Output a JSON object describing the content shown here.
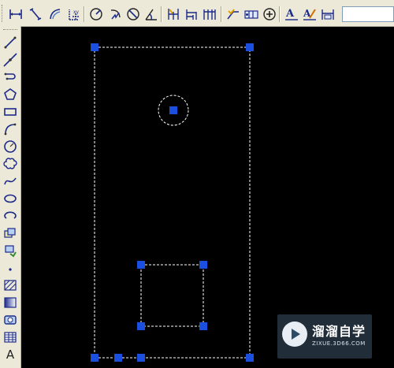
{
  "top_toolbar": {
    "tools": [
      {
        "name": "linear-dimension-icon"
      },
      {
        "name": "aligned-dimension-icon"
      },
      {
        "name": "arc-length-dimension-icon"
      },
      {
        "name": "ordinate-dimension-icon"
      },
      {
        "name": "radius-dimension-icon"
      },
      {
        "name": "jogged-dimension-icon"
      },
      {
        "name": "diameter-dimension-icon"
      },
      {
        "name": "angular-dimension-icon"
      },
      {
        "name": "quick-dimension-icon"
      },
      {
        "name": "baseline-dimension-icon"
      },
      {
        "name": "continue-dimension-icon"
      },
      {
        "name": "quick-leader-icon"
      },
      {
        "name": "tolerance-icon"
      },
      {
        "name": "center-mark-icon"
      },
      {
        "name": "dimension-edit-icon"
      },
      {
        "name": "dimension-text-edit-icon"
      },
      {
        "name": "dimension-update-icon"
      }
    ],
    "dim_style_value": ""
  },
  "left_toolbar": {
    "tools": [
      {
        "name": "line-icon"
      },
      {
        "name": "construction-line-icon"
      },
      {
        "name": "polyline-icon"
      },
      {
        "name": "polygon-icon"
      },
      {
        "name": "rectangle-icon"
      },
      {
        "name": "arc-icon"
      },
      {
        "name": "circle-icon"
      },
      {
        "name": "revision-cloud-icon"
      },
      {
        "name": "spline-icon"
      },
      {
        "name": "ellipse-icon"
      },
      {
        "name": "ellipse-arc-icon"
      },
      {
        "name": "insert-block-icon"
      },
      {
        "name": "make-block-icon"
      },
      {
        "name": "point-icon"
      },
      {
        "name": "hatch-icon"
      },
      {
        "name": "gradient-icon"
      },
      {
        "name": "region-icon"
      },
      {
        "name": "table-icon"
      },
      {
        "name": "multiline-text-icon"
      }
    ],
    "text_tool_label": "A"
  },
  "colors": {
    "canvas_background": "#000000",
    "grip_color": "#1a4fe0",
    "selection_line": "#ffffff",
    "toolbar_background": "#ece9d8"
  },
  "watermark": {
    "title": "溜溜自学",
    "url": "ZIXUE.3D66.COM"
  }
}
